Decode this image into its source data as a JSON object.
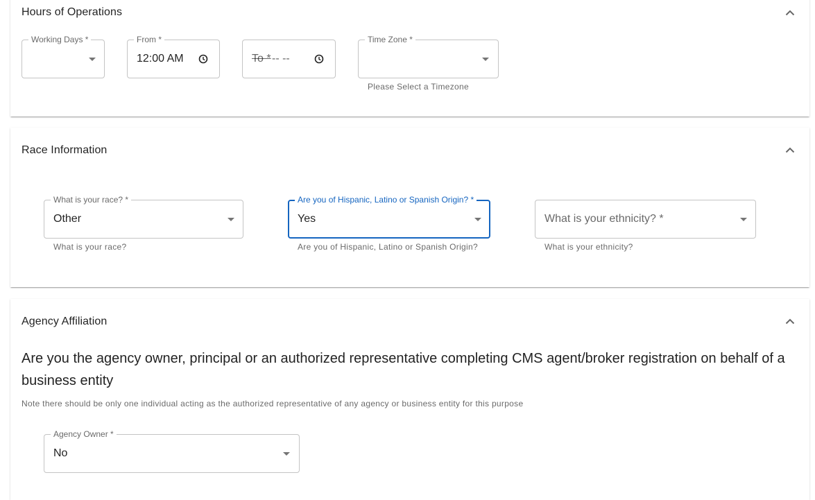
{
  "hours": {
    "title": "Hours of Operations",
    "working_days_label": "Working Days *",
    "working_days_value": "",
    "from_label": "From *",
    "from_value": "12:00 AM",
    "to_label": "To *",
    "to_value": "-- --",
    "timezone_label": "Time Zone *",
    "timezone_value": "",
    "timezone_helper": "Please Select a Timezone"
  },
  "race": {
    "title": "Race Information",
    "race_label": "What is your race? *",
    "race_value": "Other",
    "race_helper": "What is your race?",
    "hispanic_label": "Are you of Hispanic, Latino or Spanish Origin? *",
    "hispanic_value": "Yes",
    "hispanic_helper": "Are you of Hispanic, Latino or Spanish Origin?",
    "ethnicity_placeholder": "What is your ethnicity? *",
    "ethnicity_helper": "What is your ethnicity?"
  },
  "agency": {
    "title": "Agency Affiliation",
    "question": "Are you the agency owner, principal or an authorized representative completing CMS agent/broker registration on behalf of a business entity",
    "note": "Note there should be only one individual acting as the authorized representative of any agency or business entity for this purpose",
    "owner_label": "Agency Owner *",
    "owner_value": "No"
  },
  "colors": {
    "focus": "#1565c0",
    "border": "rgba(0,0,0,0.23)"
  },
  "icons": [
    "chevron-up-icon",
    "clock-icon",
    "dropdown-arrow-icon"
  ]
}
